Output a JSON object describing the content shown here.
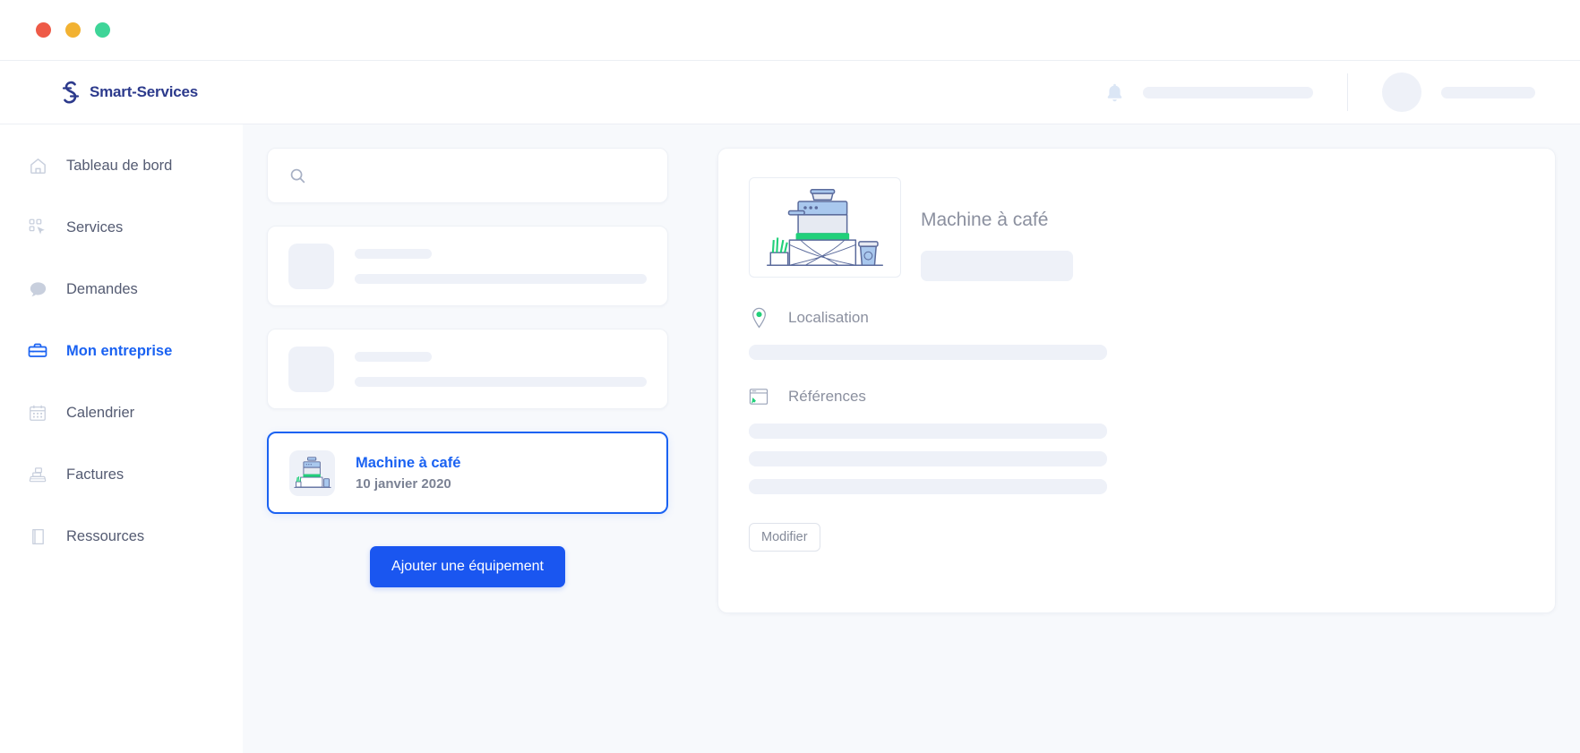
{
  "window": {
    "traffic_lights": [
      "close",
      "minimize",
      "maximize"
    ],
    "colors": {
      "close": "#ee5a47",
      "minimize": "#f2b232",
      "maximize": "#3ed598"
    }
  },
  "header": {
    "brand_name": "Smart-Services",
    "bell_icon": "bell-icon",
    "notification_placeholder": "",
    "user_name_placeholder": ""
  },
  "sidebar": {
    "items": [
      {
        "label": "Tableau de bord",
        "icon": "home-icon",
        "active": false
      },
      {
        "label": "Services",
        "icon": "grid-cursor-icon",
        "active": false
      },
      {
        "label": "Demandes",
        "icon": "chat-bubble-icon",
        "active": false
      },
      {
        "label": "Mon entreprise",
        "icon": "briefcase-icon",
        "active": true
      },
      {
        "label": "Calendrier",
        "icon": "calendar-icon",
        "active": false
      },
      {
        "label": "Factures",
        "icon": "cash-register-icon",
        "active": false
      },
      {
        "label": "Ressources",
        "icon": "book-icon",
        "active": false
      }
    ]
  },
  "search": {
    "icon": "search-icon",
    "value": "",
    "placeholder": ""
  },
  "equipment_list": {
    "skeleton_items": [
      {
        "thumb": "placeholder",
        "line_short": "",
        "line_long": ""
      },
      {
        "thumb": "placeholder",
        "line_short": "",
        "line_long": ""
      }
    ],
    "selected_item": {
      "title": "Machine à café",
      "date": "10 janvier 2020",
      "icon": "coffee-machine-illustration"
    },
    "add_button_label": "Ajouter une équipement"
  },
  "detail_panel": {
    "illustration": "coffee-machine-illustration",
    "title": "Machine à café",
    "name_value": "",
    "fields": [
      {
        "label": "Localisation",
        "icon": "map-pin-icon",
        "bars": 1
      },
      {
        "label": "Références",
        "icon": "window-icon",
        "bars": 3
      }
    ],
    "edit_button_label": "Modifier"
  },
  "colors": {
    "accent_blue": "#1a56f0",
    "link_blue": "#1a62f2",
    "brand_navy": "#2c3a8c",
    "skeleton": "#eef1f8",
    "page_bg": "#f7f9fc",
    "green": "#21d07a"
  }
}
